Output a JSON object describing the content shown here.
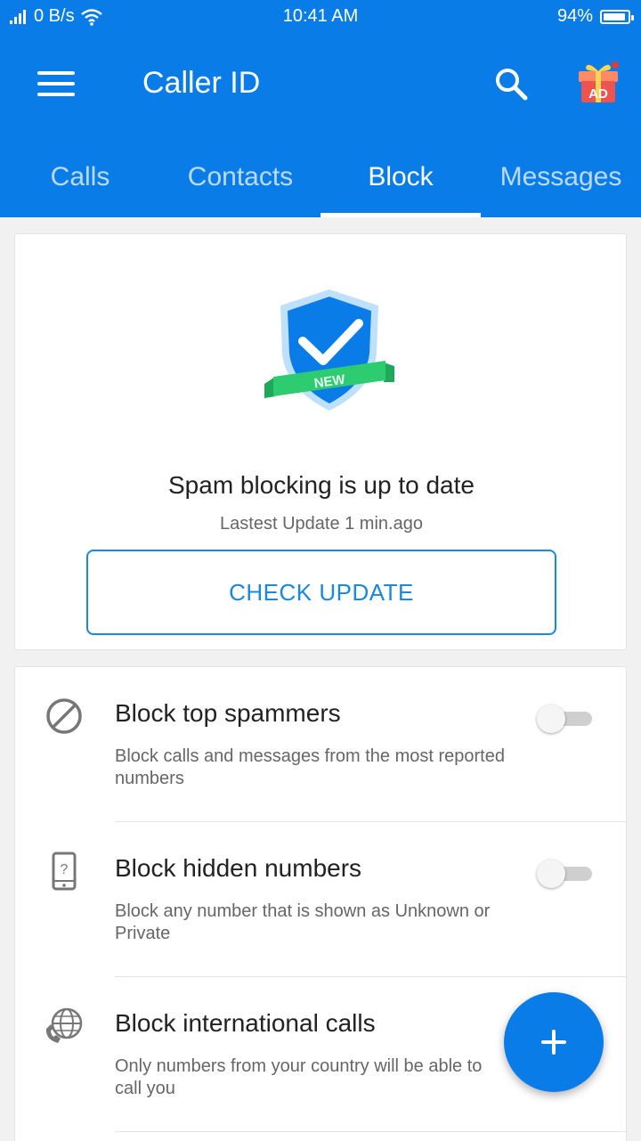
{
  "status_bar": {
    "net_speed": "0 B/s",
    "time": "10:41 AM",
    "battery": "94%",
    "battery_level": 0.94
  },
  "app_bar": {
    "title": "Caller ID",
    "menu_icon": "hamburger-menu-icon",
    "search_icon": "search-icon",
    "gift_icon": "gift-ad-icon",
    "gift_badge": "AD"
  },
  "tabs": [
    {
      "label": "Calls",
      "active": false
    },
    {
      "label": "Contacts",
      "active": false
    },
    {
      "label": "Block",
      "active": true
    },
    {
      "label": "Messages",
      "active": false
    }
  ],
  "update_card": {
    "shield_icon": "shield-check-icon",
    "badge": "NEW",
    "title": "Spam blocking is up to date",
    "subtitle": "Lastest Update 1 min.ago",
    "button_label": "CHECK UPDATE"
  },
  "block_settings": [
    {
      "icon": "block-circle-icon",
      "title": "Block top spammers",
      "description": "Block calls and messages from the most reported numbers",
      "enabled": false
    },
    {
      "icon": "hidden-number-phone-icon",
      "title": "Block hidden numbers",
      "description": "Block any number that is shown as Unknown or Private",
      "enabled": false
    },
    {
      "icon": "globe-phone-icon",
      "title": "Block international calls",
      "description": "Only numbers from your country will be able to call you",
      "enabled": false
    }
  ],
  "fab": {
    "icon": "plus-icon"
  },
  "colors": {
    "primary": "#0a7ce8",
    "accent": "#1a88dc",
    "badge_green": "#2ecc71"
  }
}
